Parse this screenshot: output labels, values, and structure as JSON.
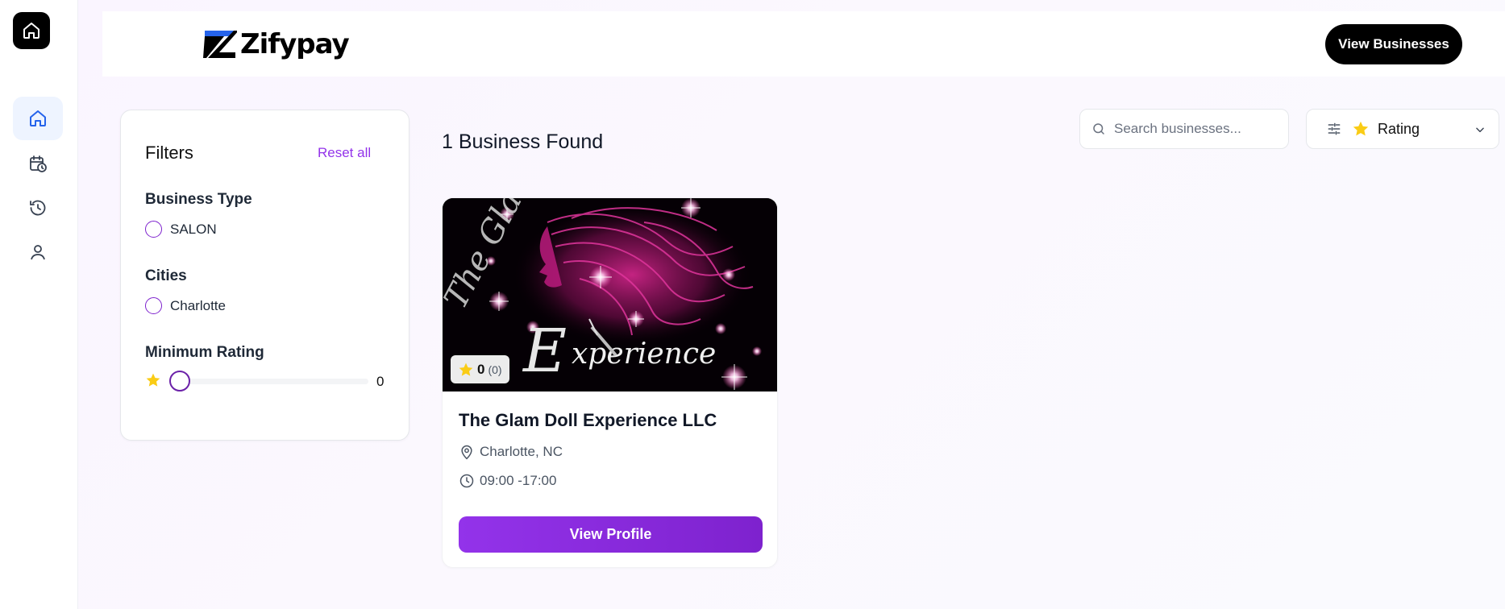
{
  "nav": {
    "items": [
      {
        "name": "home",
        "active": true
      },
      {
        "name": "appointments",
        "active": false
      },
      {
        "name": "history",
        "active": false
      },
      {
        "name": "profile",
        "active": false
      }
    ]
  },
  "header": {
    "brand": "Zifypay",
    "view_businesses_label": "View Businesses"
  },
  "filters": {
    "title": "Filters",
    "reset_label": "Reset all",
    "business_type": {
      "title": "Business Type",
      "options": [
        "SALON"
      ]
    },
    "cities": {
      "title": "Cities",
      "options": [
        "Charlotte"
      ]
    },
    "minimum_rating": {
      "title": "Minimum Rating",
      "value": "0"
    }
  },
  "results": {
    "heading": "1 Business Found",
    "search_placeholder": "Search businesses...",
    "sort_label": "Rating",
    "businesses": [
      {
        "name": "The Glam Doll Experience LLC",
        "location": "Charlotte, NC",
        "hours": "09:00 -17:00",
        "rating": "0",
        "review_count": "(0)",
        "cta": "View Profile",
        "image_text": "The Glam Experience"
      }
    ]
  },
  "colors": {
    "accent": "#9333ea",
    "accent_dark": "#7e22ce",
    "star": "#facc15",
    "nav_active": "#2563eb"
  }
}
